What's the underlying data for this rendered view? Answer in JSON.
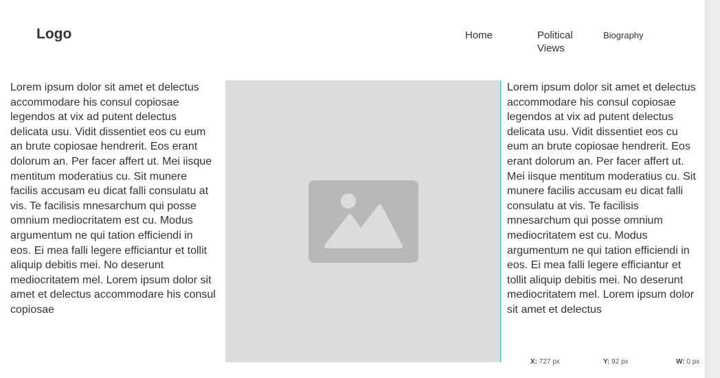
{
  "header": {
    "logo": "Logo",
    "nav": [
      {
        "label": "Home"
      },
      {
        "label": "Political Views"
      },
      {
        "label": "Biography"
      }
    ]
  },
  "content": {
    "left_text": "Lorem ipsum dolor sit amet et delectus accommodare his consul copiosae legendos at vix ad putent delectus delicata usu. Vidit dissentiet eos cu eum an brute copiosae hendrerit. Eos erant dolorum an. Per facer affert ut. Mei iisque mentitum moderatius cu. Sit munere facilis accusam eu dicat falli consulatu at vis. Te facilisis mnesarchum qui posse omnium mediocritatem est cu. Modus argumentum ne qui tation efficiendi in eos. Ei mea falli legere efficiantur et tollit aliquip debitis mei. No deserunt mediocritatem mel. Lorem ipsum dolor sit amet et delectus accommodare his consul copiosae",
    "right_text": "Lorem ipsum dolor sit amet et delectus accommodare his consul copiosae legendos at vix ad putent delectus delicata usu. Vidit dissentiet eos cu eum an brute copiosae hendrerit. Eos erant dolorum an. Per facer affert ut. Mei iisque mentitum moderatius cu. Sit munere facilis accusam eu dicat falli consulatu at vis. Te facilisis mnesarchum qui posse omnium mediocritatem est cu. Modus argumentum ne qui tation efficiendi in eos. Ei mea falli legere efficiantur et tollit aliquip debitis mei. No deserunt mediocritatem mel. Lorem ipsum dolor sit amet et delectus",
    "image_icon": "image-placeholder-icon"
  },
  "statusbar": {
    "x_label": "X:",
    "x_value": "727 px",
    "y_label": "Y:",
    "y_value": "92 px",
    "w_label": "W:",
    "w_value": "0 px"
  },
  "colors": {
    "guide": "#26c6da",
    "placeholder_bg": "#dcdcdc",
    "placeholder_icon": "#b8b8b8"
  }
}
